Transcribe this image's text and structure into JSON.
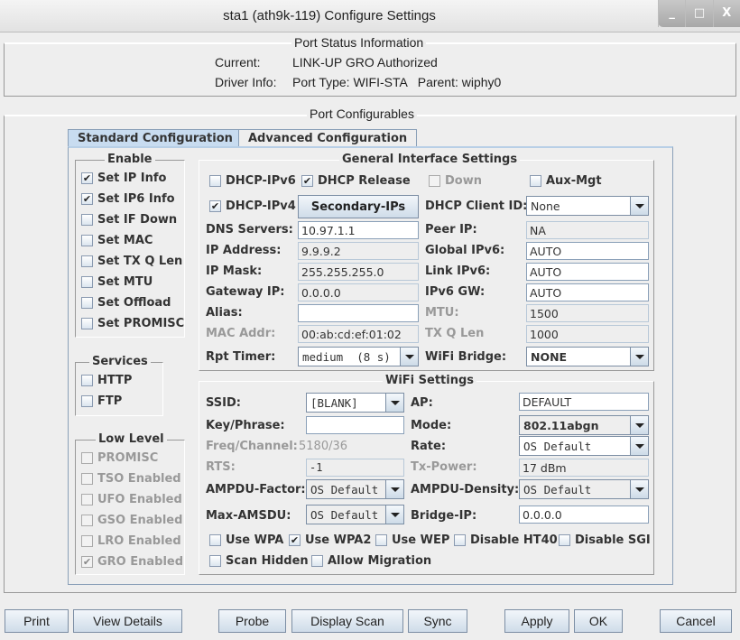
{
  "window": {
    "title": "sta1  (ath9k-119) Configure Settings",
    "minimize": "_",
    "maximize": "□",
    "close": "X"
  },
  "status": {
    "title": "Port Status Information",
    "current_label": "Current:",
    "current_value": "LINK-UP GRO  Authorized",
    "driver_label": "Driver Info:",
    "driver_value": "Port Type: WIFI-STA   Parent: wiphy0"
  },
  "configurables": {
    "title": "Port Configurables"
  },
  "tabs": [
    {
      "label": "Standard Configuration",
      "active": true
    },
    {
      "label": "Advanced Configuration",
      "active": false
    }
  ],
  "enable": {
    "title": "Enable",
    "items": [
      {
        "label": "Set IP Info",
        "checked": true
      },
      {
        "label": "Set IP6 Info",
        "checked": true
      },
      {
        "label": "Set IF Down",
        "checked": false
      },
      {
        "label": "Set MAC",
        "checked": false
      },
      {
        "label": "Set TX Q Len",
        "checked": false
      },
      {
        "label": "Set MTU",
        "checked": false
      },
      {
        "label": "Set Offload",
        "checked": false
      },
      {
        "label": "Set PROMISC",
        "checked": false
      }
    ]
  },
  "services": {
    "title": "Services",
    "items": [
      {
        "label": "HTTP",
        "checked": false
      },
      {
        "label": "FTP",
        "checked": false
      }
    ]
  },
  "lowlevel": {
    "title": "Low Level",
    "items": [
      {
        "label": "PROMISC",
        "checked": false
      },
      {
        "label": "TSO Enabled",
        "checked": false
      },
      {
        "label": "UFO Enabled",
        "checked": false
      },
      {
        "label": "GSO Enabled",
        "checked": false
      },
      {
        "label": "LRO Enabled",
        "checked": false
      },
      {
        "label": "GRO Enabled",
        "checked": true
      }
    ]
  },
  "general": {
    "title": "General Interface Settings",
    "dhcp_ipv6": "DHCP-IPv6",
    "dhcp_release": "DHCP Release",
    "down": "Down",
    "aux_mgt": "Aux-Mgt",
    "dhcp_ipv4": "DHCP-IPv4",
    "secondary_ips": "Secondary-IPs",
    "dhcp_client_id_label": "DHCP Client ID:",
    "dhcp_client_id": "None",
    "dns_label": "DNS Servers:",
    "dns": "10.97.1.1",
    "peer_ip_label": "Peer IP:",
    "peer_ip": "NA",
    "ip_label": "IP Address:",
    "ip": "9.9.9.2",
    "global_ipv6_label": "Global IPv6:",
    "global_ipv6": "AUTO",
    "mask_label": "IP Mask:",
    "mask": "255.255.255.0",
    "link_ipv6_label": "Link IPv6:",
    "link_ipv6": "AUTO",
    "gw_label": "Gateway IP:",
    "gw": "0.0.0.0",
    "ipv6_gw_label": "IPv6 GW:",
    "ipv6_gw": "AUTO",
    "alias_label": "Alias:",
    "alias": "",
    "mtu_label": "MTU:",
    "mtu": "1500",
    "mac_label": "MAC Addr:",
    "mac": "00:ab:cd:ef:01:02",
    "txq_label": "TX Q Len",
    "txq": "1000",
    "rpt_label": "Rpt Timer:",
    "rpt": "medium  (8 s)",
    "bridge_label": "WiFi Bridge:",
    "bridge": "NONE"
  },
  "wifi": {
    "title": "WiFi Settings",
    "ssid_label": "SSID:",
    "ssid": "[BLANK]",
    "ap_label": "AP:",
    "ap": "DEFAULT",
    "key_label": "Key/Phrase:",
    "key": "",
    "mode_label": "Mode:",
    "mode": "802.11abgn",
    "freq_label": "Freq/Channel:",
    "freq": "5180/36",
    "rate_label": "Rate:",
    "rate": "OS Default",
    "rts_label": "RTS:",
    "rts": "-1",
    "txpower_label": "Tx-Power:",
    "txpower": "17 dBm",
    "ampdu_factor_label": "AMPDU-Factor:",
    "ampdu_factor": "OS Default",
    "ampdu_density_label": "AMPDU-Density:",
    "ampdu_density": "OS Default",
    "max_amsdu_label": "Max-AMSDU:",
    "max_amsdu": "OS Default",
    "bridge_ip_label": "Bridge-IP:",
    "bridge_ip": "0.0.0.0",
    "use_wpa": "Use WPA",
    "use_wpa2": "Use WPA2",
    "use_wep": "Use WEP",
    "disable_ht40": "Disable HT40",
    "disable_sgi": "Disable SGI",
    "scan_hidden": "Scan Hidden",
    "allow_migration": "Allow Migration"
  },
  "buttons": {
    "print": "Print",
    "view_details": "View Details",
    "probe": "Probe",
    "display_scan": "Display Scan",
    "sync": "Sync",
    "apply": "Apply",
    "ok": "OK",
    "cancel": "Cancel"
  }
}
